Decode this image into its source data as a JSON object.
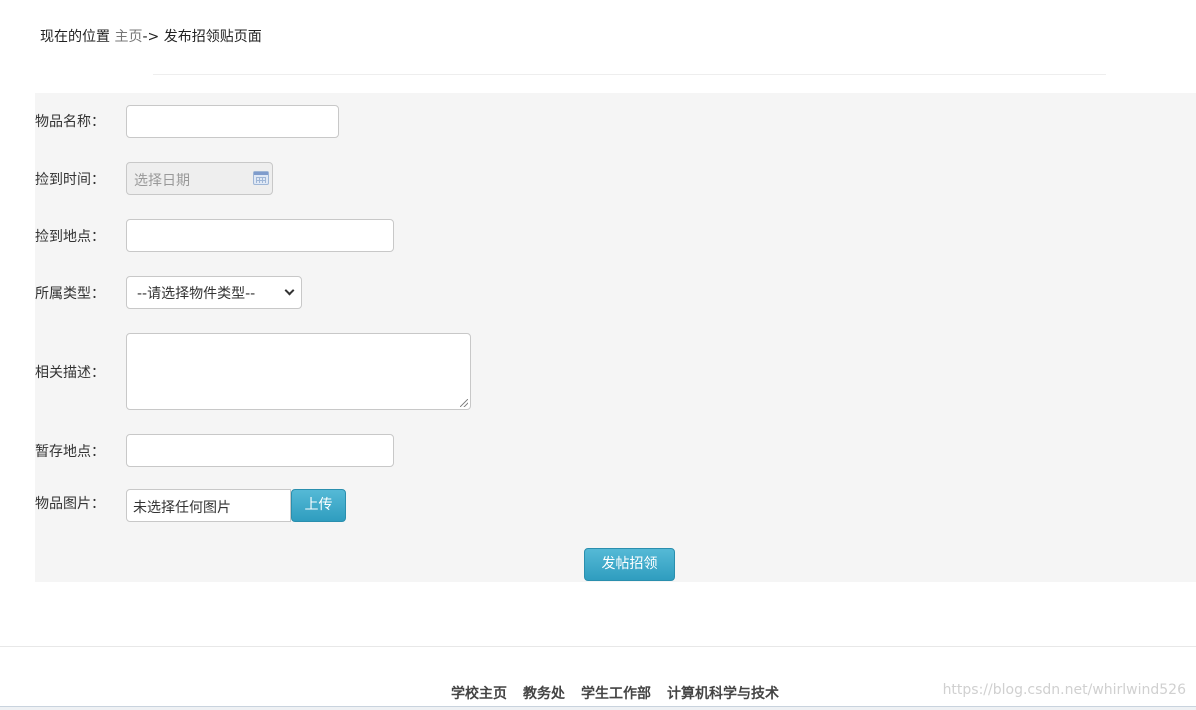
{
  "breadcrumb": {
    "prefix": "现在的位置",
    "home": "主页",
    "separator": "->",
    "current": "发布招领贴页面"
  },
  "form": {
    "item_name": {
      "label": "物品名称：",
      "value": ""
    },
    "found_time": {
      "label": "捡到时间：",
      "placeholder": "选择日期",
      "icon": "calendar-icon"
    },
    "found_place": {
      "label": "捡到地点：",
      "value": ""
    },
    "category": {
      "label": "所属类型：",
      "selected": "--请选择物件类型--"
    },
    "description": {
      "label": "相关描述：",
      "value": ""
    },
    "storage_place": {
      "label": "暂存地点：",
      "value": ""
    },
    "item_image": {
      "label": "物品图片：",
      "file_text": "未选择任何图片",
      "upload_label": "上传"
    },
    "submit_label": "发帖招领"
  },
  "footer": {
    "links": [
      "学校主页",
      "教务处",
      "学生工作部",
      "计算机科学与技术"
    ],
    "watermark": "https://blog.csdn.net/whirlwind526"
  },
  "colors": {
    "panel_bg": "#f5f5f5",
    "button_blue": "#3aa8c9"
  }
}
